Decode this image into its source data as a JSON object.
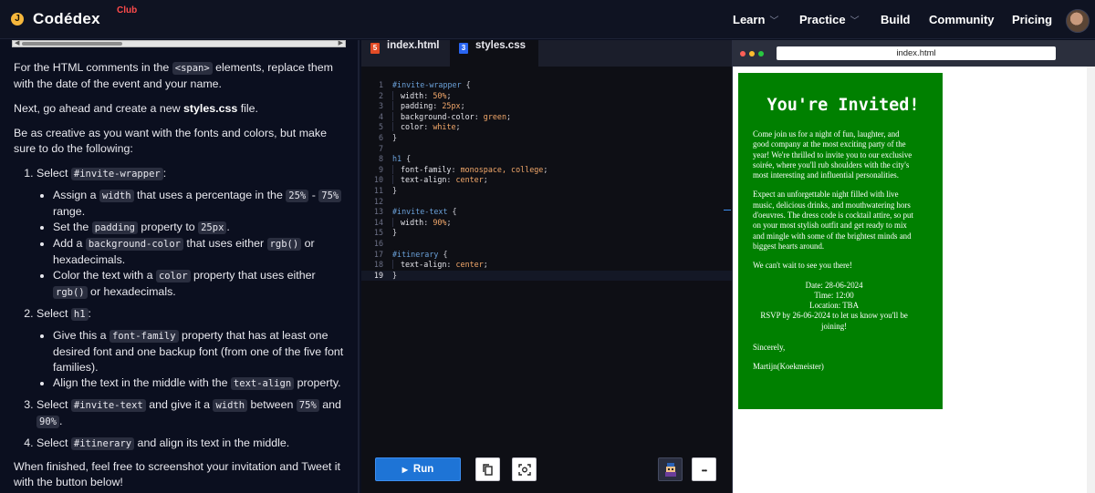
{
  "nav": {
    "logo_text": "Codédex",
    "logo_badge": "J",
    "club_label": "Club",
    "items": [
      {
        "label": "Learn",
        "dropdown": true
      },
      {
        "label": "Practice",
        "dropdown": true
      },
      {
        "label": "Build",
        "dropdown": false
      },
      {
        "label": "Community",
        "dropdown": false
      },
      {
        "label": "Pricing",
        "dropdown": false
      }
    ],
    "chevron_glyph": "﹀"
  },
  "instructions": {
    "p1_a": "For the HTML comments in the ",
    "p1_code": "<span>",
    "p1_b": " elements, replace them with the date of the event and your name.",
    "p2_a": "Next, go ahead and create a new ",
    "p2_bold": "styles.css",
    "p2_b": " file.",
    "p3": "Be as creative as you want with the fonts and colors, but make sure to do the following:",
    "step1_a": "Select ",
    "step1_code": "#invite-wrapper",
    "step1_b": ":",
    "s1b1_a": "Assign a ",
    "s1b1_code1": "width",
    "s1b1_b": " that uses a percentage in the ",
    "s1b1_code2": "25%",
    "s1b1_c": " - ",
    "s1b1_code3": "75%",
    "s1b1_d": " range.",
    "s1b2_a": "Set the ",
    "s1b2_code1": "padding",
    "s1b2_b": " property to ",
    "s1b2_code2": "25px",
    "s1b2_c": ".",
    "s1b3_a": "Add a ",
    "s1b3_code1": "background-color",
    "s1b3_b": " that uses either ",
    "s1b3_code2": "rgb()",
    "s1b3_c": " or hexadecimals.",
    "s1b4_a": "Color the text with a ",
    "s1b4_code1": "color",
    "s1b4_b": " property that uses either ",
    "s1b4_code2": "rgb()",
    "s1b4_c": " or hexadecimals.",
    "step2_a": "Select ",
    "step2_code": "h1",
    "step2_b": ":",
    "s2b1_a": "Give this a ",
    "s2b1_code": "font-family",
    "s2b1_b": " property that has at least one desired font and one backup font (from one of the five font families).",
    "s2b2_a": "Align the text in the middle with the ",
    "s2b2_code": "text-align",
    "s2b2_b": " property.",
    "step3_a": "Select ",
    "step3_code1": "#invite-text",
    "step3_b": " and give it a ",
    "step3_code2": "width",
    "step3_c": " between ",
    "step3_code3": "75%",
    "step3_d": " and ",
    "step3_code4": "90%",
    "step3_e": ".",
    "step4_a": "Select ",
    "step4_code": "#itinerary",
    "step4_b": " and align its text in the middle.",
    "p_final": "When finished, feel free to screenshot your invitation and Tweet it with the button below!"
  },
  "editor": {
    "tabs": [
      {
        "label": "index.html",
        "icon": "html5-icon",
        "active": false
      },
      {
        "label": "styles.css",
        "icon": "css3-icon",
        "active": true
      }
    ],
    "active_line": 19,
    "lines": [
      {
        "n": "1",
        "sel": "#invite-wrapper",
        "rest": " {"
      },
      {
        "n": "2",
        "prop": "width",
        "val": "50%"
      },
      {
        "n": "3",
        "prop": "padding",
        "val": "25px"
      },
      {
        "n": "4",
        "prop": "background-color",
        "val": "green"
      },
      {
        "n": "5",
        "prop": "color",
        "val": "white"
      },
      {
        "n": "6",
        "plain": "}"
      },
      {
        "n": "7",
        "plain": ""
      },
      {
        "n": "8",
        "sel": "h1",
        "rest": " {"
      },
      {
        "n": "9",
        "prop": "font-family",
        "val": "monospace, college"
      },
      {
        "n": "10",
        "prop": "text-align",
        "val": "center"
      },
      {
        "n": "11",
        "plain": "}"
      },
      {
        "n": "12",
        "plain": ""
      },
      {
        "n": "13",
        "sel": "#invite-text",
        "rest": " {"
      },
      {
        "n": "14",
        "prop": "width",
        "val": "90%"
      },
      {
        "n": "15",
        "plain": "}"
      },
      {
        "n": "16",
        "plain": ""
      },
      {
        "n": "17",
        "sel": "#itinerary",
        "rest": " {"
      },
      {
        "n": "18",
        "prop": "text-align",
        "val": "center"
      },
      {
        "n": "19",
        "plain": "}"
      }
    ],
    "run_label": "Run",
    "run_glyph": "▶",
    "more_glyph": "•••"
  },
  "preview": {
    "url": "index.html",
    "dots": [
      "#ff5f57",
      "#febc2e",
      "#28c840"
    ],
    "title": "You're Invited!",
    "p1": "Come join us for a night of fun, laughter, and good company at the most exciting party of the year! We're thrilled to invite you to our exclusive soirée, where you'll rub shoulders with the city's most interesting and influential personalities.",
    "p2": "Expect an unforgettable night filled with live music, delicious drinks, and mouthwatering hors d'oeuvres. The dress code is cocktail attire, so put on your most stylish outfit and get ready to mix and mingle with some of the brightest minds and biggest hearts around.",
    "p3": "We can't wait to see you there!",
    "itinerary": [
      "Date: 28-06-2024",
      "Time: 12:00",
      "Location: TBA",
      "RSVP by 26-06-2024 to let us know you'll be joining!"
    ],
    "closing": "Sincerely,",
    "signature": "Martijn(Koekmeister)"
  },
  "colors": {
    "invite_bg": "#008000",
    "accent_blue": "#1e74d6",
    "club_red": "#ff4b4b",
    "logo_gold": "#f6b73c"
  }
}
